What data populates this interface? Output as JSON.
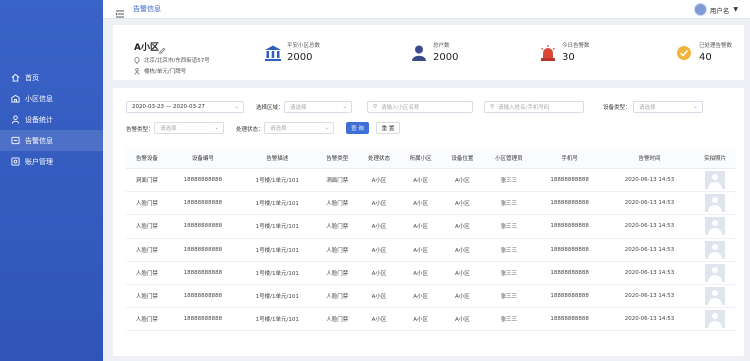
{
  "topbar": {
    "breadcrumb": "告警信息",
    "username": "用户名"
  },
  "sidebar": {
    "items": [
      {
        "label": "首页",
        "icon": "home-icon"
      },
      {
        "label": "小区信息",
        "icon": "community-icon"
      },
      {
        "label": "设备统计",
        "icon": "device-stats-icon"
      },
      {
        "label": "告警信息",
        "icon": "alarm-icon",
        "active": true
      },
      {
        "label": "账户管理",
        "icon": "account-icon"
      }
    ]
  },
  "community": {
    "name": "A小区",
    "address": "北京/北京市/东西街道57号",
    "building": "楼栋/单元/门牌号"
  },
  "stats": [
    {
      "label": "平安小区总数",
      "value": "2000",
      "icon": "bank-icon"
    },
    {
      "label": "总户数",
      "value": "2000",
      "icon": "household-icon"
    },
    {
      "label": "今日告警数",
      "value": "30",
      "icon": "siren-icon"
    },
    {
      "label": "已处理告警数",
      "value": "40",
      "icon": "handled-icon"
    }
  ],
  "filters": {
    "date_range": "2020-03-23 — 2020-03-27",
    "region_label": "选择区域：",
    "region_placeholder": "请选择",
    "community_search_placeholder": "请输入小区名称",
    "person_search_placeholder": "请输入姓名/手机号码",
    "device_type_label": "设备类型：",
    "device_type_placeholder": "请选择",
    "alarm_type_label": "告警类型：",
    "alarm_type_placeholder": "请选择",
    "status_label": "处理状态：",
    "status_placeholder": "请选择",
    "query_button": "查 询",
    "reset_button": "重 置"
  },
  "table": {
    "columns": [
      "告警设备",
      "设备编号",
      "告警描述",
      "告警类型",
      "处理状态",
      "所属小区",
      "设备位置",
      "小区管理员",
      "手机号",
      "告警时间",
      "实拍照片"
    ],
    "rows": [
      [
        "洞面门禁",
        "18888888888",
        "1号楼/1单元/101",
        "洞面门禁",
        "A小区",
        "A小区",
        "A小区",
        "张三三",
        "18888888888",
        "2020-06-13  14:53"
      ],
      [
        "人脸门禁",
        "18888888888",
        "1号楼/1单元/101",
        "人脸门禁",
        "A小区",
        "A小区",
        "A小区",
        "张三三",
        "18888888888",
        "2020-06-13  14:53"
      ],
      [
        "人脸门禁",
        "18888888888",
        "1号楼/1单元/101",
        "人脸门禁",
        "A小区",
        "A小区",
        "A小区",
        "张三三",
        "18888888888",
        "2020-06-13  14:53"
      ],
      [
        "人脸门禁",
        "18888888888",
        "1号楼/1单元/101",
        "人脸门禁",
        "A小区",
        "A小区",
        "A小区",
        "张三三",
        "18888888888",
        "2020-06-13  14:53"
      ],
      [
        "人脸门禁",
        "18888888888",
        "1号楼/1单元/101",
        "人脸门禁",
        "A小区",
        "A小区",
        "A小区",
        "张三三",
        "18888888888",
        "2020-06-13  14:53"
      ],
      [
        "人脸门禁",
        "18888888888",
        "1号楼/1单元/101",
        "人脸门禁",
        "A小区",
        "A小区",
        "A小区",
        "张三三",
        "18888888888",
        "2020-06-13  14:53"
      ],
      [
        "人脸门禁",
        "18888888888",
        "1号楼/1单元/101",
        "人脸门禁",
        "A小区",
        "A小区",
        "A小区",
        "张三三",
        "18888888888",
        "2020-06-13  14:53"
      ]
    ]
  },
  "colors": {
    "sidebar": "#3a63c7",
    "primary": "#3f6fd6",
    "background": "#eef0f5"
  }
}
